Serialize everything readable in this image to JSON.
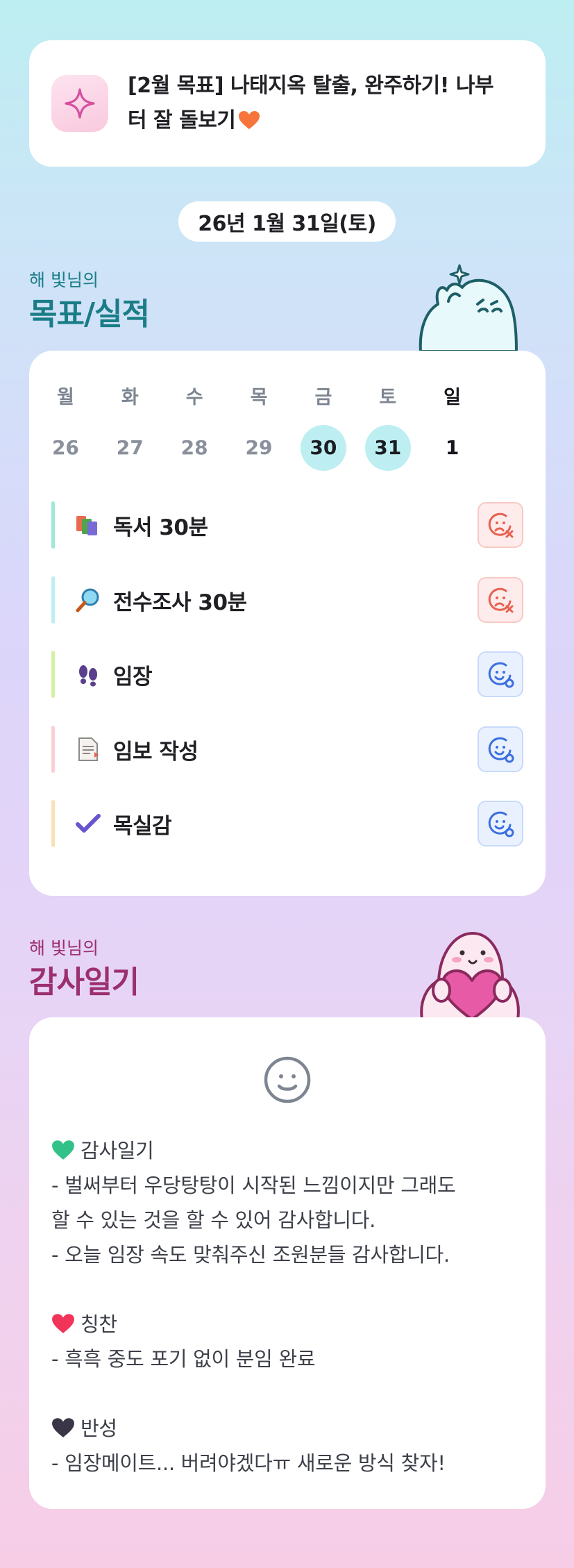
{
  "goal": {
    "icon": "sparkle-icon",
    "line1": "[2월 목표] 나태지옥 탈출, 완주하기! 나부",
    "line2": "터 잘 돌보기"
  },
  "date_label": "26년 1월 31일(토)",
  "goals_section": {
    "subtitle": "해 빛님의",
    "title": "목표/실적",
    "weekdays": [
      "월",
      "화",
      "수",
      "목",
      "금",
      "토",
      "일"
    ],
    "dates": [
      "26",
      "27",
      "28",
      "29",
      "30",
      "31",
      "1"
    ],
    "selected_dates": [
      "30",
      "31"
    ],
    "tasks": [
      {
        "label": "독서 30분",
        "icon": "books-icon",
        "bar_color": "#9ee8d8",
        "status": "fail"
      },
      {
        "label": "전수조사 30분",
        "icon": "magnifier-icon",
        "bar_color": "#bdeef2",
        "status": "fail"
      },
      {
        "label": "임장",
        "icon": "footprints-icon",
        "bar_color": "#d2f0a8",
        "status": "done"
      },
      {
        "label": "임보 작성",
        "icon": "document-icon",
        "bar_color": "#fbd0d4",
        "status": "done"
      },
      {
        "label": "목실감",
        "icon": "checkmark-icon",
        "bar_color": "#fbe0b8",
        "status": "done"
      }
    ]
  },
  "gratitude_section": {
    "subtitle": "해 빛님의",
    "title": "감사일기",
    "mood_icon": "smile-icon",
    "blocks": [
      {
        "heading": "감사일기",
        "heart_color": "#33c18a",
        "lines": [
          "- 벌써부터 우당탕탕이 시작된 느낌이지만 그래도",
          "할 수 있는 것을 할 수 있어 감사합니다.",
          "- 오늘 임장 속도 맞춰주신 조원분들 감사합니다."
        ]
      },
      {
        "heading": "칭찬",
        "heart_color": "#f2335a",
        "lines": [
          "- 흑흑 중도 포기 없이 분임 완료"
        ]
      },
      {
        "heading": "반성",
        "heart_color": "#3b3548",
        "lines": [
          "- 임장메이트... 버려야겠다ㅠ 새로운 방식 찾자!"
        ]
      }
    ]
  },
  "colors": {
    "goals_title": "#1a7d86",
    "gratitude_title": "#9c2f6e",
    "fail": "#e8604f",
    "done": "#3b6fe0"
  }
}
